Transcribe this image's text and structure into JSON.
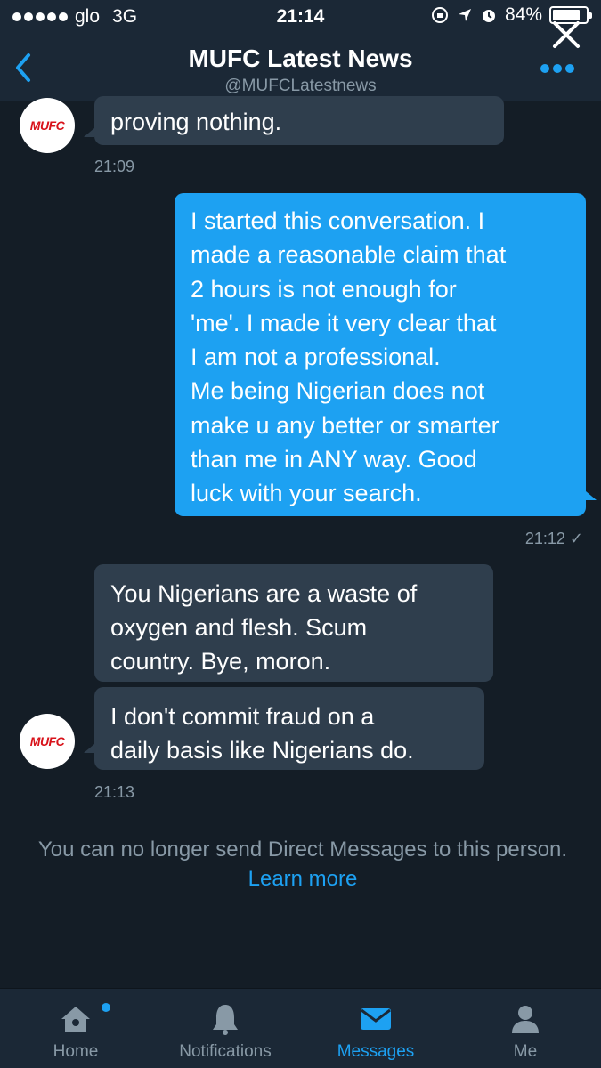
{
  "status_bar": {
    "carrier": "glo",
    "network": "3G",
    "time": "21:14",
    "battery": "84%",
    "battery_level": 0.84
  },
  "header": {
    "title": "MUFC Latest News",
    "handle": "@MUFCLatestnews"
  },
  "conversation": {
    "avatar_text": "MUFC",
    "msg1": {
      "text": "proving nothing.",
      "time": "21:09"
    },
    "msg2": {
      "lines": [
        "I started this conversation. I",
        "made a reasonable claim that",
        "2 hours is not enough for",
        "'me'. I made it very clear that",
        "I am not a professional.",
        "Me being Nigerian does not",
        "make u any better or smarter",
        "than me in ANY way. Good",
        "luck with your search."
      ],
      "time": "21:12 ✓"
    },
    "msg3": {
      "lines": [
        "You Nigerians are a waste of",
        "oxygen and flesh. Scum",
        "country. Bye, moron."
      ]
    },
    "msg4": {
      "lines": [
        "I don't commit fraud on a",
        "daily basis like Nigerians do."
      ],
      "time": "21:13"
    },
    "notice_text": "You can no longer send Direct Messages to this person.",
    "notice_link": "Learn more"
  },
  "tabbar": {
    "home": "Home",
    "notifications": "Notifications",
    "messages": "Messages",
    "me": "Me"
  },
  "colors": {
    "background": "#141d26",
    "bar": "#1b2836",
    "accent": "#1da1f2",
    "incoming_bubble": "#2f3e4d",
    "muted_text": "#8899a6"
  }
}
